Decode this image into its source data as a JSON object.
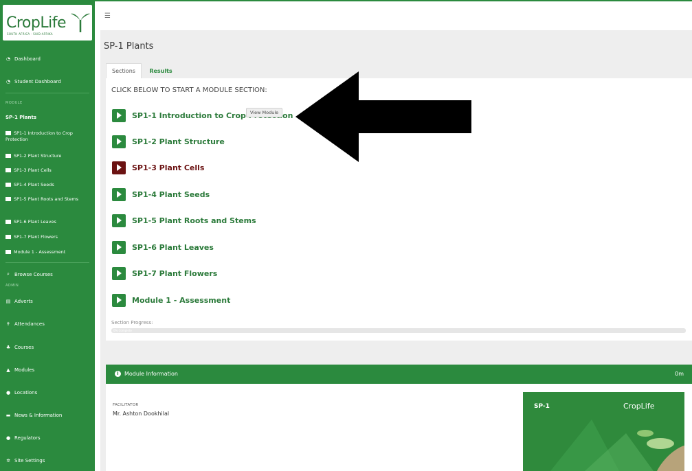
{
  "brand": {
    "logo_text": "CropLife",
    "logo_sub": "SOUTH AFRICA · SUID-AFRIKA"
  },
  "sidebar": {
    "dashboard": "Dashboard",
    "student_dashboard": "Student Dashboard",
    "module_heading": "MODULE",
    "current_module": "SP-1 Plants",
    "sections": [
      "SP1-1 Introduction to Crop Protection",
      "SP1-2 Plant Structure",
      "SP1-3 Plant Cells",
      "SP1-4 Plant Seeds",
      "SP1-5 Plant Roots and Stems",
      "SP1-6 Plant Leaves",
      "SP1-7 Plant Flowers",
      "Module 1 - Assessment"
    ],
    "browse_courses": "Browse Courses",
    "admin_heading": "ADMIN",
    "admin_items": [
      "Adverts",
      "Attendances",
      "Courses",
      "Modules",
      "Locations",
      "News & Information",
      "Regulators",
      "Site Settings"
    ]
  },
  "page": {
    "title": "SP-1 Plants",
    "tabs": [
      "Sections",
      "Results"
    ],
    "heading": "CLICK BELOW TO START A MODULE SECTION:",
    "modules": [
      "SP1-1 Introduction to Crop Protection",
      "SP1-2 Plant Structure",
      "SP1-3 Plant Cells",
      "SP1-4 Plant Seeds",
      "SP1-5 Plant Roots and Stems",
      "SP1-6 Plant Leaves",
      "SP1-7 Plant Flowers",
      "Module 1 - Assessment"
    ],
    "active_module_index": 2,
    "tooltip": "View Module",
    "progress_label": "Section Progress:",
    "progress_text": "0% Complete"
  },
  "module_info": {
    "title": "Module Information",
    "duration": "0m",
    "facilitator_label": "FACILITATOR",
    "facilitator_name": "Mr. Ashton Dookhilal",
    "thumb_code": "SP-1",
    "thumb_brand": "CropLife"
  },
  "colors": {
    "brand_green": "#2b8a3e",
    "active_maroon": "#6b1212"
  }
}
